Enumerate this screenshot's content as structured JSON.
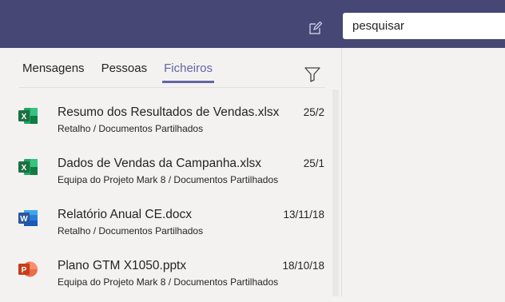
{
  "header": {
    "compose_icon": "compose-icon",
    "search": {
      "value": "pesquisar",
      "placeholder": "pesquisar"
    }
  },
  "tabs": [
    {
      "label": "Mensagens",
      "active": false
    },
    {
      "label": "Pessoas",
      "active": false
    },
    {
      "label": "Ficheiros",
      "active": true
    }
  ],
  "filter_icon": "filter-icon",
  "files": [
    {
      "name": "Resumo dos Resultados de Vendas.xlsx",
      "location": "Retalho / Documentos Partilhados",
      "date": "25/2",
      "type": "excel-file-icon"
    },
    {
      "name": "Dados de Vendas da Campanha.xlsx",
      "location": "Equipa do Projeto Mark 8 / Documentos Partilhados",
      "date": "25/1",
      "type": "excel-file-icon"
    },
    {
      "name": "Relatório Anual CE.docx",
      "location": "Retalho / Documentos Partilhados",
      "date": "13/11/18",
      "type": "word-file-icon"
    },
    {
      "name": "Plano GTM X1050.pptx",
      "location": "Equipa do Projeto Mark 8 / Documentos Partilhados",
      "date": "18/10/18",
      "type": "powerpoint-file-icon"
    }
  ],
  "colors": {
    "header_bg": "#464775",
    "accent": "#6264a7",
    "excel": "#1d6f42",
    "word": "#2b579a",
    "powerpoint": "#d24726",
    "pane_bg": "#f3f2f1"
  }
}
